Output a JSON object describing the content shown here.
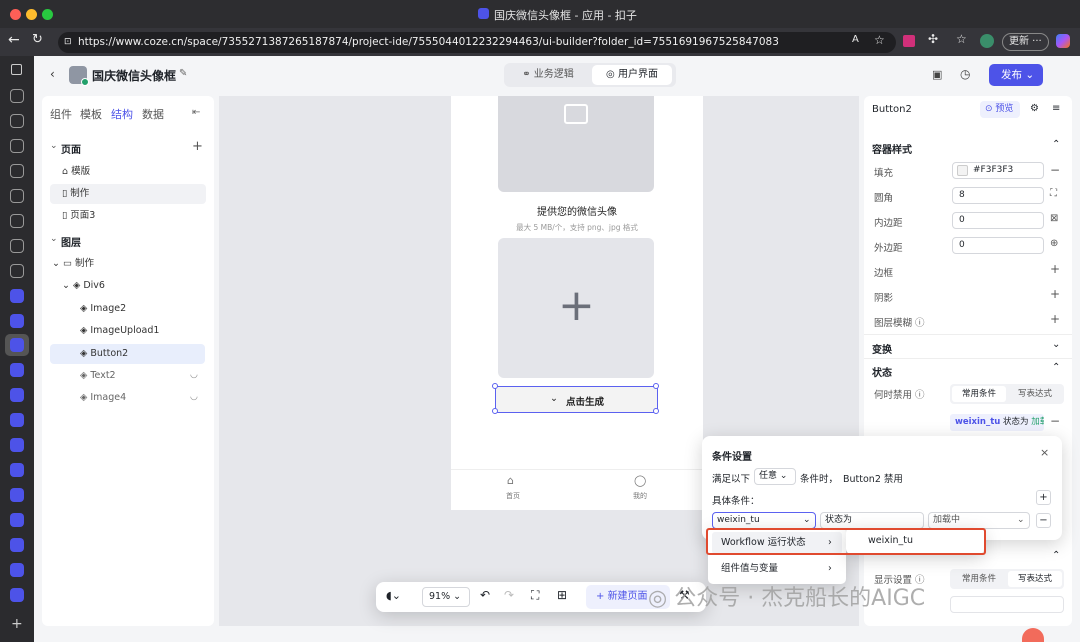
{
  "window": {
    "title": "国庆微信头像框 - 应用 - 扣子"
  },
  "browser": {
    "url": "https://www.coze.cn/space/7355271387265187874/project-ide/7555044012232294463/ui-builder?folder_id=7551691967525847083",
    "update_label": "更新"
  },
  "header": {
    "project_title": "国庆微信头像框",
    "tab_logic": "业务逻辑",
    "tab_ui": "用户界面",
    "publish_label": "发布"
  },
  "left": {
    "tabs": [
      "组件",
      "模板",
      "结构",
      "数据"
    ],
    "pages_label": "页面",
    "page_items": [
      "模版",
      "制作",
      "页面3"
    ],
    "layers_label": "图层",
    "layer_root": "制作",
    "layer_div": "Div6",
    "layer_items": [
      "Image2",
      "ImageUpload1",
      "Button2",
      "Text2",
      "Image4"
    ]
  },
  "canvas": {
    "upload_title": "提供您的微信头像",
    "upload_hint": "最大 5 MB/个，支持 png、jpg 格式",
    "button_label": "点击生成",
    "nav_home": "首页",
    "nav_mine": "我的",
    "zoom": "91%",
    "new_page_label": "新建页面"
  },
  "props": {
    "component_name": "Button2",
    "preview_label": "预览",
    "container_style": "容器样式",
    "fill_label": "填充",
    "fill_value": "#F3F3F3",
    "radius_label": "圆角",
    "radius_value": "8",
    "padding_label": "内边距",
    "padding_value": "0",
    "margin_label": "外边距",
    "margin_value": "0",
    "border_label": "边框",
    "shadow_label": "阴影",
    "blur_label": "图层模糊",
    "transform_label": "变换",
    "state_label": "状态",
    "disable_when_label": "何时禁用",
    "common_cond": "常用条件",
    "write_expr": "写表达式",
    "cond_tag_var": "weixin_tu",
    "cond_tag_text": "状态为",
    "cond_tag_value": "加载",
    "display_label": "显示设置",
    "display_common": "常用条件",
    "display_expr": "写表达式"
  },
  "condition_popup": {
    "title": "条件设置",
    "sentence_prefix": "满足以下",
    "any_label": "任意",
    "sentence_mid": "条件时，",
    "sentence_target": "Button2 禁用",
    "specific_label": "具体条件：",
    "field_var": "weixin_tu",
    "field_state": "状态为",
    "field_value": "加载中"
  },
  "dropdown": {
    "item_workflow": "Workflow 运行状态",
    "item_components": "组件值与变量",
    "sub_item": "weixin_tu"
  },
  "watermark": {
    "text": "公众号 · 杰克船长的AIGC"
  },
  "colors": {
    "accent": "#4d53e8",
    "selected": "#e8eefc"
  }
}
